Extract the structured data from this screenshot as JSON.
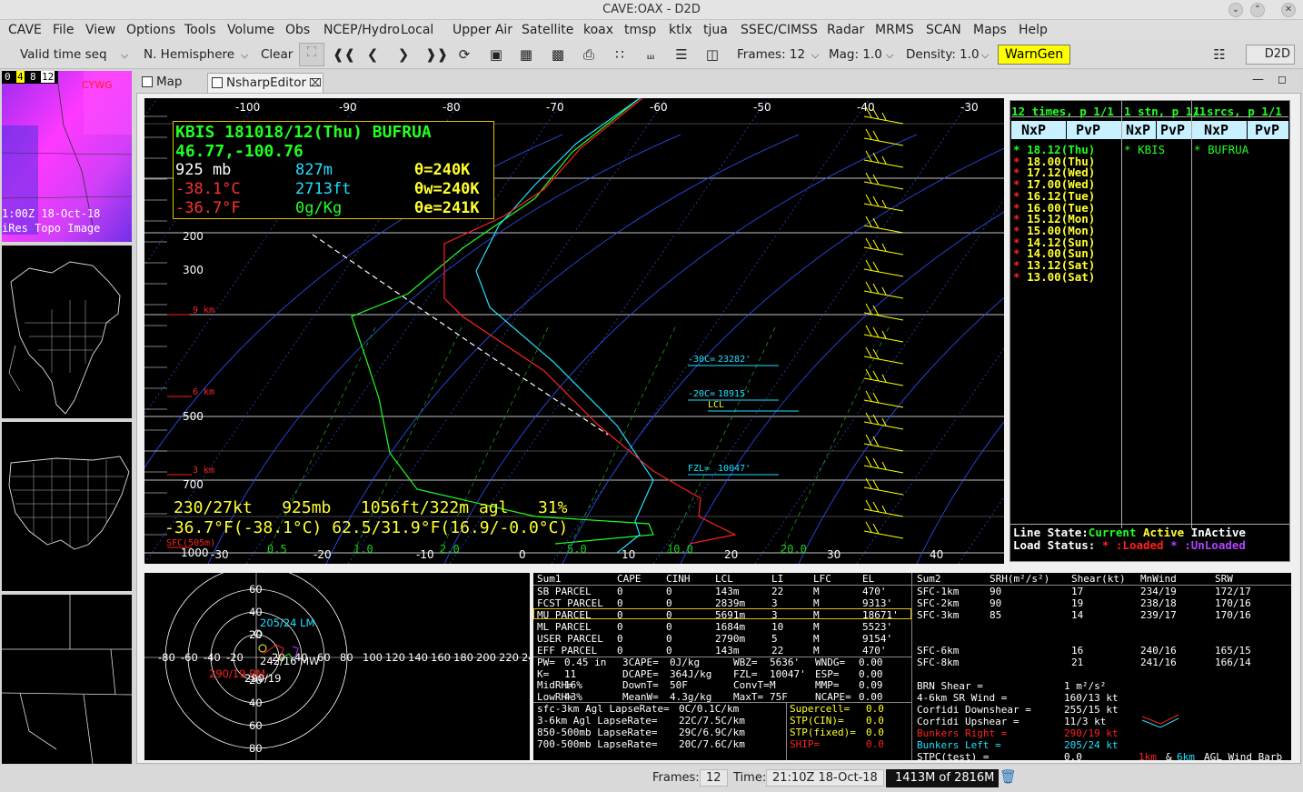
{
  "window": {
    "title": "CAVE:OAX - D2D"
  },
  "menu": [
    "CAVE",
    "File",
    "View",
    "Options",
    "Tools",
    "Volume",
    "Obs",
    "NCEP/Hydro",
    "Local",
    "Upper Air",
    "Satellite",
    "koax",
    "tmsp",
    "ktlx",
    "tjua",
    "SSEC/CIMSS",
    "Radar",
    "MRMS",
    "SCAN",
    "Maps",
    "Help"
  ],
  "toolbar": {
    "valid_time": "Valid time seq",
    "projection": "N. Hemisphere",
    "clear": "Clear",
    "frames": "Frames: 12",
    "mag": "Mag: 1.0",
    "density": "Density: 1.0",
    "warngen": "WarnGen",
    "perspective": "D2D"
  },
  "thumb": {
    "frames": [
      "0",
      "4",
      "8",
      "12"
    ],
    "station": "CYWG",
    "time": "1:00Z 18-Oct-18",
    "product": "iRes Topo Image"
  },
  "tabs": [
    {
      "label": "Map"
    },
    {
      "label": "NsharpEditor"
    }
  ],
  "skewt": {
    "info": {
      "line1": "KBIS 181018/12(Thu) BUFRUA",
      "line2": "46.77,-100.76",
      "pres": "925 mb",
      "hgt_m": "827m",
      "theta": "θ=240K",
      "temp_c": "-38.1°C",
      "hgt_ft": "2713ft",
      "thetaw": "θw=240K",
      "temp_f": "-36.7°F",
      "mix": "0g/Kg",
      "thetae": "θe=241K"
    },
    "readout1": "230/27kt   925mb   1056ft/322m agl   31%",
    "readout2": "-36.7°F(-38.1°C) 62.5/31.9°F(16.9/-0.0°C)",
    "top_ticks": [
      "-100",
      "-90",
      "-80",
      "-70",
      "-60",
      "-50",
      "-40",
      "-30"
    ],
    "bottom_ticks": [
      "-30",
      "-20",
      "-10",
      "0",
      "10",
      "20",
      "30",
      "40"
    ],
    "pressure_labels": [
      "200",
      "300",
      "500",
      "700",
      "1000"
    ],
    "km_labels": [
      "9 km",
      "6 km",
      "3 km",
      "SFC(505m)"
    ],
    "mix_labels": [
      "0.5",
      "1.0",
      "2.0",
      "5.0",
      "10.0",
      "20.0"
    ],
    "levels": [
      {
        "label": "-30C=",
        "value": "23282'"
      },
      {
        "label": "-20C=",
        "value": "18915'"
      },
      {
        "label": "LCL",
        "value": ""
      },
      {
        "label": "FZL=",
        "value": "10047'"
      }
    ]
  },
  "timeline": {
    "header": [
      "12 times, p 1/1",
      "1 stn, p 1/1",
      "1 srcs, p 1/1"
    ],
    "cols": [
      "NxP",
      "PvP",
      "NxP",
      "PvP",
      "NxP",
      "PvP"
    ],
    "times": [
      "18.12(Thu)",
      "18.00(Thu)",
      "17.12(Wed)",
      "17.00(Wed)",
      "16.12(Tue)",
      "16.00(Tue)",
      "15.12(Mon)",
      "15.00(Mon)",
      "14.12(Sun)",
      "14.00(Sun)",
      "13.12(Sat)",
      "13.00(Sat)"
    ],
    "station": "KBIS",
    "source": "BUFRUA",
    "line_state_label": "Line State:",
    "current": "Current",
    "active": "Active",
    "inactive": "InActive",
    "load_status_label": "Load Status:",
    "loaded": ":Loaded",
    "unloaded": ":UnLoaded",
    "star": "*"
  },
  "hodo": {
    "rings": [
      "20",
      "40",
      "60",
      "80"
    ],
    "axis": [
      "-80",
      "-60",
      "-40",
      "-20",
      "20",
      "40",
      "60",
      "80",
      "100",
      "120",
      "140",
      "160",
      "180",
      "200",
      "220",
      "240"
    ],
    "left_mover": "205/24 LM",
    "right_mover": "290/19 RM",
    "mean_wind": "242/16 MW",
    "corfidi": "290/19"
  },
  "sum1": {
    "headers": [
      "Sum1",
      "CAPE",
      "CINH",
      "LCL",
      "LI",
      "LFC",
      "EL"
    ],
    "rows": [
      [
        "SB PARCEL",
        "0",
        "0",
        "143m",
        "22",
        "M",
        "470'"
      ],
      [
        "FCST PARCEL",
        "0",
        "0",
        "2839m",
        "3",
        "M",
        "9313'"
      ],
      [
        "MU PARCEL",
        "0",
        "0",
        "5691m",
        "3",
        "M",
        "18671'"
      ],
      [
        "ML PARCEL",
        "0",
        "0",
        "1684m",
        "10",
        "M",
        "5523'"
      ],
      [
        "USER PARCEL",
        "0",
        "0",
        "2790m",
        "5",
        "M",
        "9154'"
      ],
      [
        "EFF PARCEL",
        "0",
        "0",
        "143m",
        "22",
        "M",
        "470'"
      ]
    ],
    "params": [
      [
        "PW=",
        "0.45 in",
        "3CAPE=",
        "0J/kg",
        "WBZ=",
        "5636'",
        "WNDG=",
        "0.00"
      ],
      [
        "K=",
        "11",
        "DCAPE=",
        "364J/kg",
        "FZL=",
        "10047'",
        "ESP=",
        "0.00"
      ],
      [
        "MidRH=",
        "16%",
        "DownT=",
        "50F",
        "ConvT=",
        "M",
        "MMP=",
        "0.09"
      ],
      [
        "LowRH=",
        "43%",
        "MeanW=",
        "4.3g/kg",
        "MaxT=",
        "75F",
        "NCAPE=",
        "0.00"
      ]
    ],
    "lapse": [
      [
        "sfc-3km Agl LapseRate=",
        "0C/0.1C/km"
      ],
      [
        "3-6km Agl LapseRate=",
        "22C/7.5C/km"
      ],
      [
        "850-500mb LapseRate=",
        "29C/6.9C/km"
      ],
      [
        "700-500mb LapseRate=",
        "20C/7.6C/km"
      ]
    ],
    "composites": [
      [
        "Supercell=",
        "0.0"
      ],
      [
        "STP(CIN)=",
        "0.0"
      ],
      [
        "STP(fixed)=",
        "0.0"
      ],
      [
        "SHIP=",
        "0.0"
      ]
    ]
  },
  "sum2": {
    "headers": [
      "Sum2",
      "SRH(m²/s²)",
      "Shear(kt)",
      "MnWind",
      "SRW"
    ],
    "rows": [
      [
        "SFC-1km",
        "90",
        "17",
        "234/19",
        "172/17"
      ],
      [
        "SFC-2km",
        "90",
        "19",
        "238/18",
        "170/16"
      ],
      [
        "SFC-3km",
        "85",
        "14",
        "239/17",
        "170/16"
      ],
      [
        "SFC-6km",
        "",
        "16",
        "240/16",
        "165/15"
      ],
      [
        "SFC-8km",
        "",
        "21",
        "241/16",
        "166/14"
      ]
    ],
    "extra": [
      [
        "BRN Shear =",
        "1 m²/s²"
      ],
      [
        "4-6km SR Wind =",
        "160/13 kt"
      ],
      [
        "Corfidi Downshear =",
        "255/15 kt"
      ],
      [
        "Corfidi Upshear =",
        "11/3 kt"
      ],
      [
        "Bunkers Right =",
        "290/19 kt"
      ],
      [
        "Bunkers Left =",
        "205/24 kt"
      ],
      [
        "STPC(test) =",
        "0.0"
      ]
    ],
    "legend_1km": "1km",
    "legend_amp": "&",
    "legend_6km": "6km",
    "legend_rest": "AGL Wind Barb"
  },
  "status": {
    "frames_label": "Frames:",
    "frames_value": "12",
    "time_label": "Time:",
    "time_value": "21:10Z 18-Oct-18",
    "memory": "1413M of 2816M"
  },
  "colors": {
    "temp": "#ff0000",
    "dewpoint": "#00ff00",
    "virtual": "#00ffff",
    "barbs": "#ffff00",
    "isobar": "#ffffff",
    "isotherm": "#3a5cff",
    "mix": "#22aa22"
  }
}
